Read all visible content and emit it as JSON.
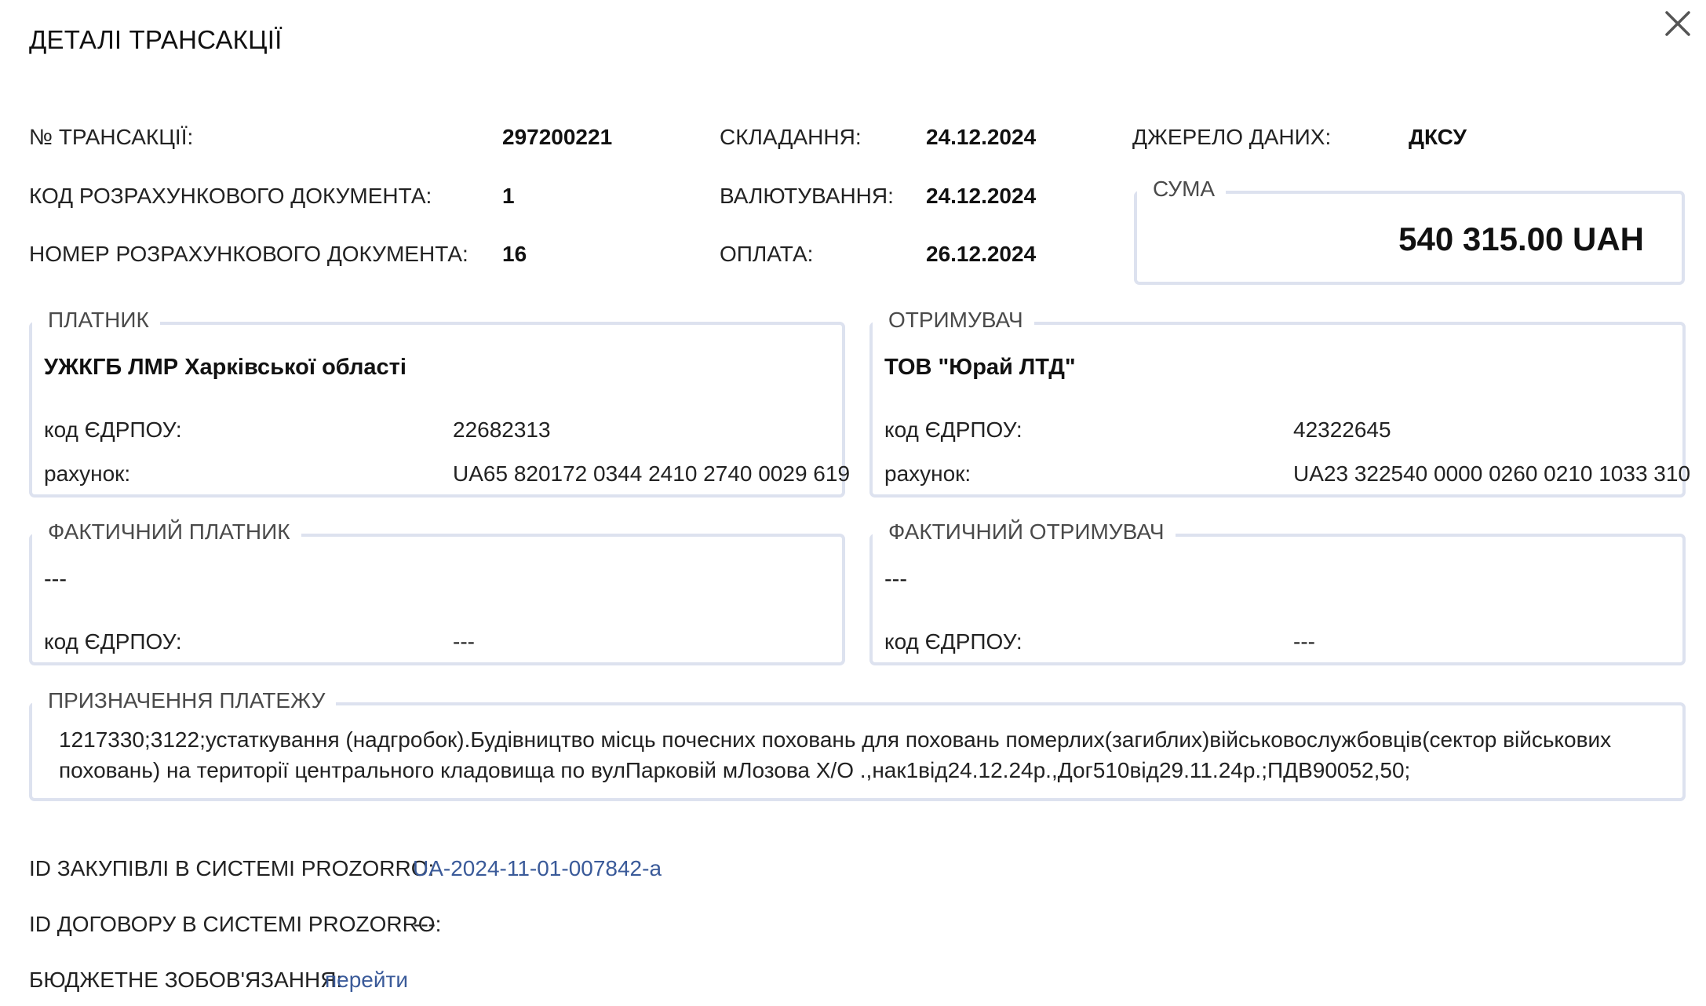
{
  "dialog": {
    "title": "ДЕТАЛІ ТРАНСАКЦІЇ",
    "close_icon": "close-icon"
  },
  "info": {
    "transaction_no_label": "№ ТРАНСАКЦІЇ:",
    "transaction_no": "297200221",
    "doc_code_label": "КОД РОЗРАХУНКОВОГО ДОКУМЕНТА:",
    "doc_code": "1",
    "doc_number_label": "НОМЕР РОЗРАХУНКОВОГО ДОКУМЕНТА:",
    "doc_number": "16",
    "compiled_label": "СКЛАДАННЯ:",
    "compiled_date": "24.12.2024",
    "valuation_label": "ВАЛЮТУВАННЯ:",
    "valuation_date": "24.12.2024",
    "payment_label": "ОПЛАТА:",
    "payment_date": "26.12.2024",
    "source_label": "ДЖЕРЕЛО ДАНИХ:",
    "source": "ДКСУ"
  },
  "amount": {
    "legend": "СУМА",
    "value": "540 315.00 UAH"
  },
  "payer": {
    "legend": "ПЛАТНИК",
    "name": "УЖКГБ ЛМР Харківської області",
    "edrpou_label": "код ЄДРПОУ:",
    "edrpou": "22682313",
    "account_label": "рахунок:",
    "account": "UA65 820172 0344 2410 2740 0029 619"
  },
  "recipient": {
    "legend": "ОТРИМУВАЧ",
    "name": "ТОВ \"Юрай ЛТД\"",
    "edrpou_label": "код ЄДРПОУ:",
    "edrpou": "42322645",
    "account_label": "рахунок:",
    "account": "UA23 322540 0000 0260 0210 1033 310"
  },
  "actual_payer": {
    "legend": "ФАКТИЧНИЙ ПЛАТНИК",
    "name": "---",
    "edrpou_label": "код ЄДРПОУ:",
    "edrpou": "---"
  },
  "actual_recipient": {
    "legend": "ФАКТИЧНИЙ ОТРИМУВАЧ",
    "name": "---",
    "edrpou_label": "код ЄДРПОУ:",
    "edrpou": "---"
  },
  "purpose": {
    "legend": "ПРИЗНАЧЕННЯ ПЛАТЕЖУ",
    "line1": "1217330;3122;устаткування (надгробок).Будівництво місць почесних поховань для поховань померлих(загиблих)військовослужбовців(сектор військових",
    "line2": "поховань) на території центрального кладовища по вулПарковій мЛозова Х/О .,нак1від24.12.24р.,Дог510від29.11.24р.;ПДВ90052,50;"
  },
  "footer": {
    "procurement_label": "ID ЗАКУПІВЛІ В СИСТЕМІ PROZORRO:",
    "procurement_id": "UA-2024-11-01-007842-a",
    "contract_label": "ID ДОГОВОРУ В СИСТЕМІ PROZORRO:",
    "contract_id": "---",
    "budget_label": "БЮДЖЕТНЕ ЗОБОВ'ЯЗАННЯ:",
    "budget_link": "перейти"
  },
  "colors": {
    "border": "#dde2ef",
    "link": "#3a5a99",
    "text": "#1c1c1c"
  }
}
